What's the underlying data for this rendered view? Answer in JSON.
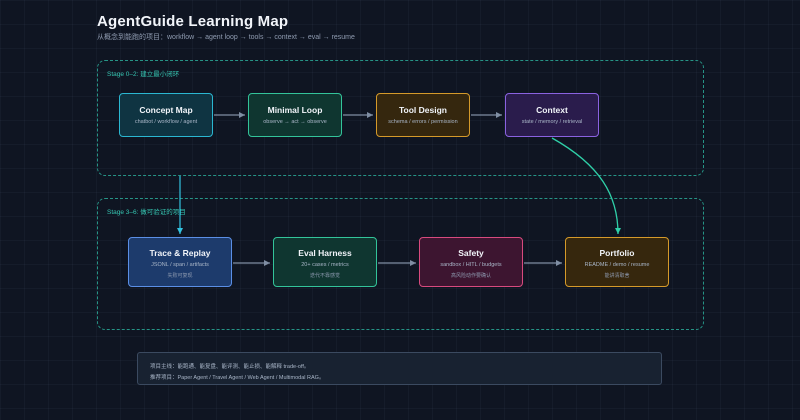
{
  "header": {
    "title": "AgentGuide Learning Map",
    "subtitle": "从概念到能跑的项目：workflow → agent loop → tools → context → eval → resume"
  },
  "stages": [
    {
      "label": "Stage 0–2: 建立最小闭环"
    },
    {
      "label": "Stage 3–6: 做可验证的项目"
    }
  ],
  "nodes": [
    {
      "title": "Concept Map",
      "sub": "chatbot / workflow / agent"
    },
    {
      "title": "Minimal Loop",
      "sub": "observe → act → observe"
    },
    {
      "title": "Tool Design",
      "sub": "schema / errors / permission"
    },
    {
      "title": "Context",
      "sub": "state / memory / retrieval"
    },
    {
      "title": "Trace & Replay",
      "sub": "JSONL / span / artifacts",
      "note": "失败可复现"
    },
    {
      "title": "Eval Harness",
      "sub": "20+ cases / metrics",
      "note": "迭代不靠感觉"
    },
    {
      "title": "Safety",
      "sub": "sandbox / HITL / budgets",
      "note": "高风险动作要确认"
    },
    {
      "title": "Portfolio",
      "sub": "README / demo / resume",
      "note": "能讲清取舍"
    }
  ],
  "info": {
    "line1": "项目主线：能跑通、能复盘、能评测、能止损、能解释 trade-off。",
    "line2": "推荐项目：Paper Agent / Travel Agent / Web Agent / Multimodal RAG。"
  },
  "colors": {
    "stage_border": "#2fbfa8",
    "arrow": "#7f8ea3",
    "accent_link": "#2fd0a8",
    "cyan_link": "#33c3e0"
  }
}
